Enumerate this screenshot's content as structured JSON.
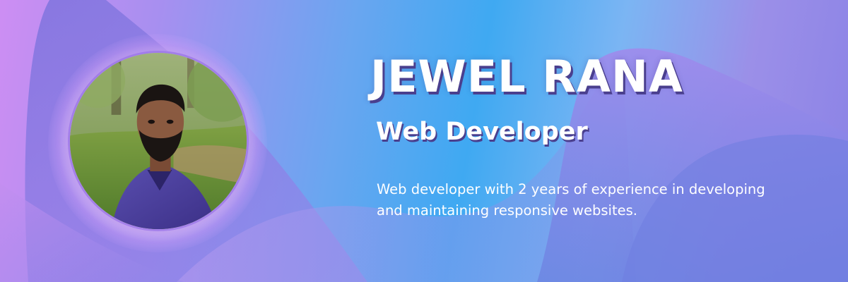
{
  "profile": {
    "name": "JEWEL RANA",
    "role": "Web Developer",
    "bio": "Web developer with 2 years of experience in developing and maintaining responsive websites."
  },
  "colors": {
    "text": "#ffffff",
    "text_shadow": "#4a3f8e",
    "gradient_left": "#cd8ef3",
    "gradient_mid": "#3fa9f2",
    "gradient_right": "#8a82e6"
  },
  "avatar": {
    "icon": "profile-photo"
  }
}
